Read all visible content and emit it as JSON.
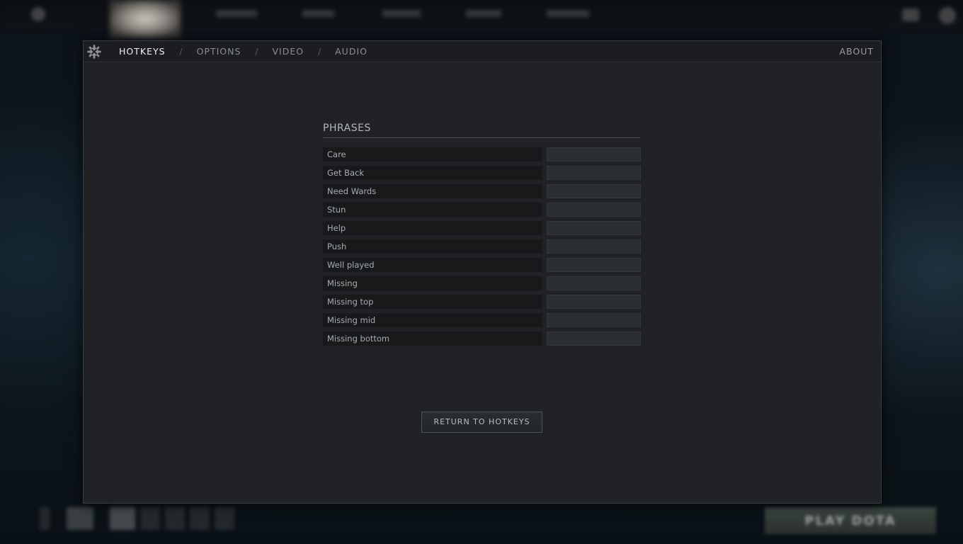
{
  "header": {
    "tabs": [
      {
        "label": "HOTKEYS",
        "active": true
      },
      {
        "label": "OPTIONS",
        "active": false
      },
      {
        "label": "VIDEO",
        "active": false
      },
      {
        "label": "AUDIO",
        "active": false
      }
    ],
    "separator": "/",
    "about_label": "ABOUT"
  },
  "phrases": {
    "title": "PHRASES",
    "items": [
      {
        "label": "Care",
        "key": ""
      },
      {
        "label": "Get Back",
        "key": ""
      },
      {
        "label": "Need Wards",
        "key": ""
      },
      {
        "label": "Stun",
        "key": ""
      },
      {
        "label": "Help",
        "key": ""
      },
      {
        "label": "Push",
        "key": ""
      },
      {
        "label": "Well played",
        "key": ""
      },
      {
        "label": "Missing",
        "key": ""
      },
      {
        "label": "Missing top",
        "key": ""
      },
      {
        "label": "Missing mid",
        "key": ""
      },
      {
        "label": "Missing bottom",
        "key": ""
      }
    ]
  },
  "return_button_label": "RETURN TO HOTKEYS",
  "background": {
    "play_button_label": "PLAY DOTA"
  },
  "colors": {
    "panel_bg": "#202225",
    "header_bg": "#1b1d20",
    "active_tab": "#eef0f2",
    "inactive_tab": "#8a8e92"
  }
}
